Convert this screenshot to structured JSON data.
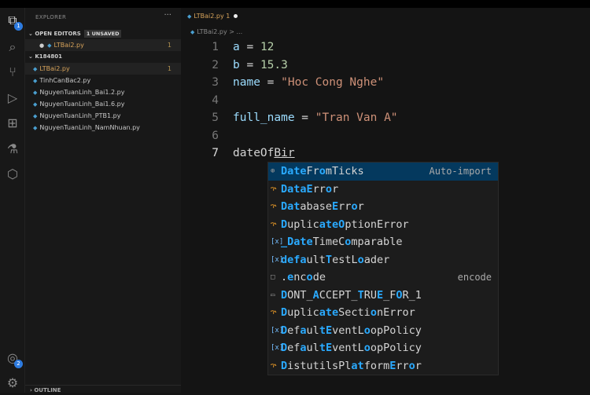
{
  "activity": {
    "explorer_badge": "1",
    "accounts_badge": "2"
  },
  "sidebar": {
    "title": "EXPLORER",
    "more": "···",
    "open_editors": {
      "label": "OPEN EDITORS",
      "badge": "1 UNSAVED",
      "files": [
        {
          "name": "LTBai2.py",
          "count": "1"
        }
      ]
    },
    "folder": {
      "label": "K184801",
      "files": [
        {
          "name": "LTBai2.py",
          "count": "1"
        },
        {
          "name": "TinhCanBac2.py"
        },
        {
          "name": "NguyenTuanLinh_Bai1.2.py"
        },
        {
          "name": "NguyenTuanLinh_Bai1.6.py"
        },
        {
          "name": "NguyenTuanLinh_PTB1.py"
        },
        {
          "name": "NguyenTuanLinh_NamNhuan.py"
        }
      ]
    },
    "outline": "OUTLINE"
  },
  "editor": {
    "tab": {
      "name": "LTBai2.py",
      "count": "1"
    },
    "breadcrumb": "LTBai2.py > ...",
    "lines": [
      {
        "n": "1",
        "parts": [
          [
            "a",
            "var"
          ],
          [
            " = ",
            "op"
          ],
          [
            "12",
            "num"
          ]
        ]
      },
      {
        "n": "2",
        "parts": [
          [
            "b",
            "var"
          ],
          [
            " = ",
            "op"
          ],
          [
            "15.3",
            "num"
          ]
        ]
      },
      {
        "n": "3",
        "parts": [
          [
            "name",
            "var"
          ],
          [
            " = ",
            "op"
          ],
          [
            "\"Hoc Cong Nghe\"",
            "str"
          ]
        ]
      },
      {
        "n": "4",
        "parts": []
      },
      {
        "n": "5",
        "parts": [
          [
            "full_name",
            "var"
          ],
          [
            " = ",
            "op"
          ],
          [
            "\"Tran Van A\"",
            "str"
          ]
        ]
      },
      {
        "n": "6",
        "parts": []
      },
      {
        "n": "7",
        "parts": [
          [
            "dateOf",
            "plain"
          ],
          [
            "Bir",
            "plain ul"
          ]
        ]
      }
    ]
  },
  "suggestions": [
    {
      "icon": "⊕",
      "kind": "method",
      "segs": [
        [
          "Date",
          1
        ],
        [
          "Fr",
          0
        ],
        [
          "o",
          1
        ],
        [
          "mTicks",
          0
        ]
      ],
      "detail": "Auto-import"
    },
    {
      "icon": "ኍ",
      "kind": "class",
      "segs": [
        [
          "Data",
          1
        ],
        [
          "E",
          1
        ],
        [
          "rr",
          0
        ],
        [
          "o",
          1
        ],
        [
          "r",
          0
        ]
      ]
    },
    {
      "icon": "ኍ",
      "kind": "class",
      "segs": [
        [
          "Dat",
          1
        ],
        [
          "abase",
          0
        ],
        [
          "E",
          1
        ],
        [
          "rr",
          0
        ],
        [
          "o",
          1
        ],
        [
          "r",
          0
        ]
      ]
    },
    {
      "icon": "ኍ",
      "kind": "class",
      "segs": [
        [
          "D",
          1
        ],
        [
          "uplic",
          0
        ],
        [
          "ate",
          1
        ],
        [
          "O",
          1
        ],
        [
          "ptionError",
          0
        ]
      ]
    },
    {
      "icon": "[x]",
      "kind": "var",
      "segs": [
        [
          "_Date",
          1
        ],
        [
          "TimeC",
          0
        ],
        [
          "o",
          1
        ],
        [
          "mparable",
          0
        ]
      ]
    },
    {
      "icon": "[x]",
      "kind": "var",
      "segs": [
        [
          "def",
          1
        ],
        [
          "a",
          1
        ],
        [
          "ult",
          0
        ],
        [
          "T",
          1
        ],
        [
          "estL",
          0
        ],
        [
          "o",
          1
        ],
        [
          "ader",
          0
        ]
      ]
    },
    {
      "icon": "□",
      "kind": "snippet",
      "segs": [
        [
          ".",
          0
        ],
        [
          "e",
          1
        ],
        [
          "nc",
          0
        ],
        [
          "o",
          1
        ],
        [
          "de",
          0
        ]
      ],
      "detail": "encode"
    },
    {
      "icon": "▭",
      "kind": "const",
      "segs": [
        [
          "D",
          1
        ],
        [
          "ONT_",
          0
        ],
        [
          "A",
          1
        ],
        [
          "CCEPT_",
          0
        ],
        [
          "T",
          1
        ],
        [
          "RU",
          0
        ],
        [
          "E",
          1
        ],
        [
          "_F",
          0
        ],
        [
          "O",
          1
        ],
        [
          "R_1",
          0
        ]
      ]
    },
    {
      "icon": "ኍ",
      "kind": "class",
      "segs": [
        [
          "D",
          1
        ],
        [
          "uplic",
          0
        ],
        [
          "ate",
          1
        ],
        [
          "Secti",
          0
        ],
        [
          "o",
          1
        ],
        [
          "nError",
          0
        ]
      ]
    },
    {
      "icon": "[x]",
      "kind": "var",
      "segs": [
        [
          "D",
          1
        ],
        [
          "ef",
          0
        ],
        [
          "a",
          1
        ],
        [
          "ul",
          0
        ],
        [
          "tE",
          1
        ],
        [
          "ventL",
          0
        ],
        [
          "o",
          1
        ],
        [
          "opPolicy",
          0
        ]
      ]
    },
    {
      "icon": "[x]",
      "kind": "var",
      "segs": [
        [
          "D",
          1
        ],
        [
          "ef",
          0
        ],
        [
          "a",
          1
        ],
        [
          "ul",
          0
        ],
        [
          "tE",
          1
        ],
        [
          "ventL",
          0
        ],
        [
          "o",
          1
        ],
        [
          "opPolicy",
          0
        ]
      ]
    },
    {
      "icon": "ኍ",
      "kind": "class",
      "segs": [
        [
          "D",
          1
        ],
        [
          "istutilsPl",
          0
        ],
        [
          "at",
          1
        ],
        [
          "form",
          0
        ],
        [
          "E",
          1
        ],
        [
          "rr",
          0
        ],
        [
          "o",
          1
        ],
        [
          "r",
          0
        ]
      ]
    }
  ]
}
